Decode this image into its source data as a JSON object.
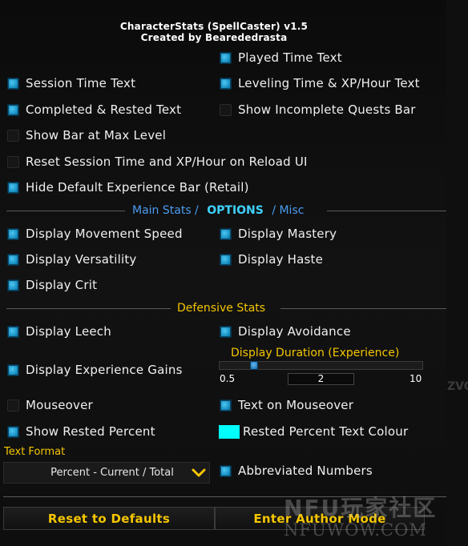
{
  "header": {
    "title": "CharacterStats (SpellCaster)  v1.5",
    "author": "Created by Bearededrasta"
  },
  "options": {
    "played_time": {
      "label": "Played Time Text",
      "checked": true
    },
    "session_time": {
      "label": "Session Time Text",
      "checked": true
    },
    "leveling_time": {
      "label": "Leveling Time & XP/Hour Text",
      "checked": true
    },
    "completed_rested": {
      "label": "Completed & Rested Text",
      "checked": true
    },
    "incomplete_quests": {
      "label": "Show Incomplete Quests Bar",
      "checked": false
    },
    "bar_max_level": {
      "label": "Show Bar at Max Level",
      "checked": false
    },
    "reset_session": {
      "label": "Reset Session Time and XP/Hour on Reload UI",
      "checked": false
    },
    "hide_default_xp": {
      "label": "Hide Default Experience Bar (Retail)",
      "checked": true
    }
  },
  "tabs": {
    "main_stats": "Main Stats /",
    "options": "OPTIONS",
    "misc": "/ Misc"
  },
  "stats": {
    "movement_speed": {
      "label": "Display Movement Speed",
      "checked": true
    },
    "mastery": {
      "label": "Display Mastery",
      "checked": true
    },
    "versatility": {
      "label": "Display Versatility",
      "checked": true
    },
    "haste": {
      "label": "Display Haste",
      "checked": true
    },
    "crit": {
      "label": "Display Crit",
      "checked": true
    }
  },
  "defensive": {
    "heading": "Defensive Stats",
    "leech": {
      "label": "Display Leech",
      "checked": true
    },
    "avoidance": {
      "label": "Display Avoidance",
      "checked": true
    }
  },
  "experience": {
    "gains": {
      "label": "Display Experience Gains",
      "checked": true
    },
    "duration_title": "Display Duration (Experience)",
    "slider_min": "0.5",
    "slider_max": "10",
    "slider_value": "2"
  },
  "mouseover": {
    "mouseover": {
      "label": "Mouseover",
      "checked": false
    },
    "text_on_mouseover": {
      "label": "Text on Mouseover",
      "checked": true
    },
    "show_rested_percent": {
      "label": "Show Rested Percent",
      "checked": true
    },
    "rested_colour_label": "Rested Percent Text Colour",
    "rested_colour": "#00ffff"
  },
  "format": {
    "label": "Text Format",
    "selected": "Percent - Current / Total",
    "abbreviated": {
      "label": "Abbreviated Numbers",
      "checked": true
    }
  },
  "footer": {
    "reset_label": "Reset to Defaults",
    "author_mode_label": "Enter Author Mode"
  },
  "watermark": {
    "line1": "NFU玩家社区",
    "line2": "NFUWOW.COM"
  },
  "edge_text": "ZVOR",
  "colors": {
    "accent_gold": "#f5c600",
    "tab_blue": "#4a9cf0",
    "tab_cyan": "#3fd2ff",
    "checkbox_blue": "#1b94c8"
  }
}
